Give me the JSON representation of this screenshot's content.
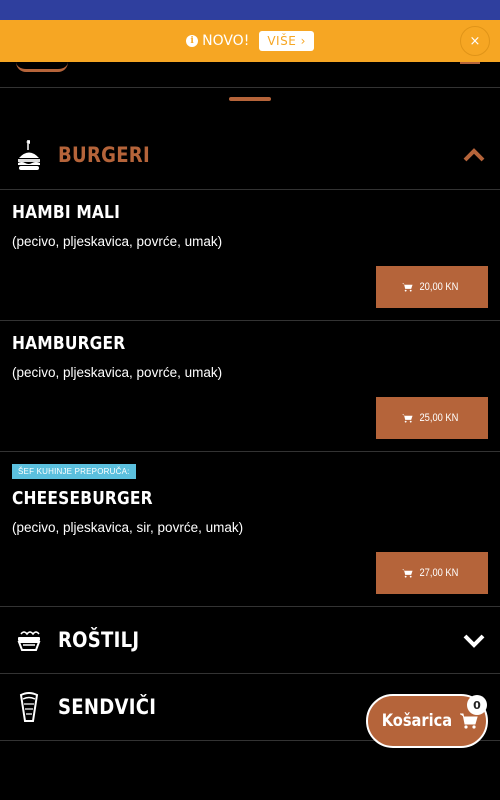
{
  "notice": {
    "text": "NOVO!",
    "more_label": "VIŠE ›",
    "close_label": "×"
  },
  "categories": [
    {
      "title": "BURGERI",
      "icon": "burger-icon",
      "expanded": true
    },
    {
      "title": "ROŠTILJ",
      "icon": "grill-icon",
      "expanded": false
    },
    {
      "title": "SENDVIČI",
      "icon": "sandwich-icon",
      "expanded": false
    }
  ],
  "items": [
    {
      "name": "HAMBI MALI",
      "description": "(pecivo, pljeskavica, povrće, umak)",
      "price": "20,00 KN"
    },
    {
      "name": "HAMBURGER",
      "description": "(pecivo, pljeskavica, povrće, umak)",
      "price": "25,00 KN"
    },
    {
      "name": "CHEESEBURGER",
      "description": "(pecivo, pljeskavica, sir, povrće, umak)",
      "price": "27,00 KN",
      "badge": "ŠEF KUHINJE PREPORUČA:"
    }
  ],
  "cart": {
    "label": "Košarica",
    "count": "0"
  },
  "colors": {
    "accent": "#b5643a",
    "notice": "#f6a623",
    "topbar": "#2f3f9e",
    "badge": "#5bc0de",
    "background": "#000000"
  }
}
